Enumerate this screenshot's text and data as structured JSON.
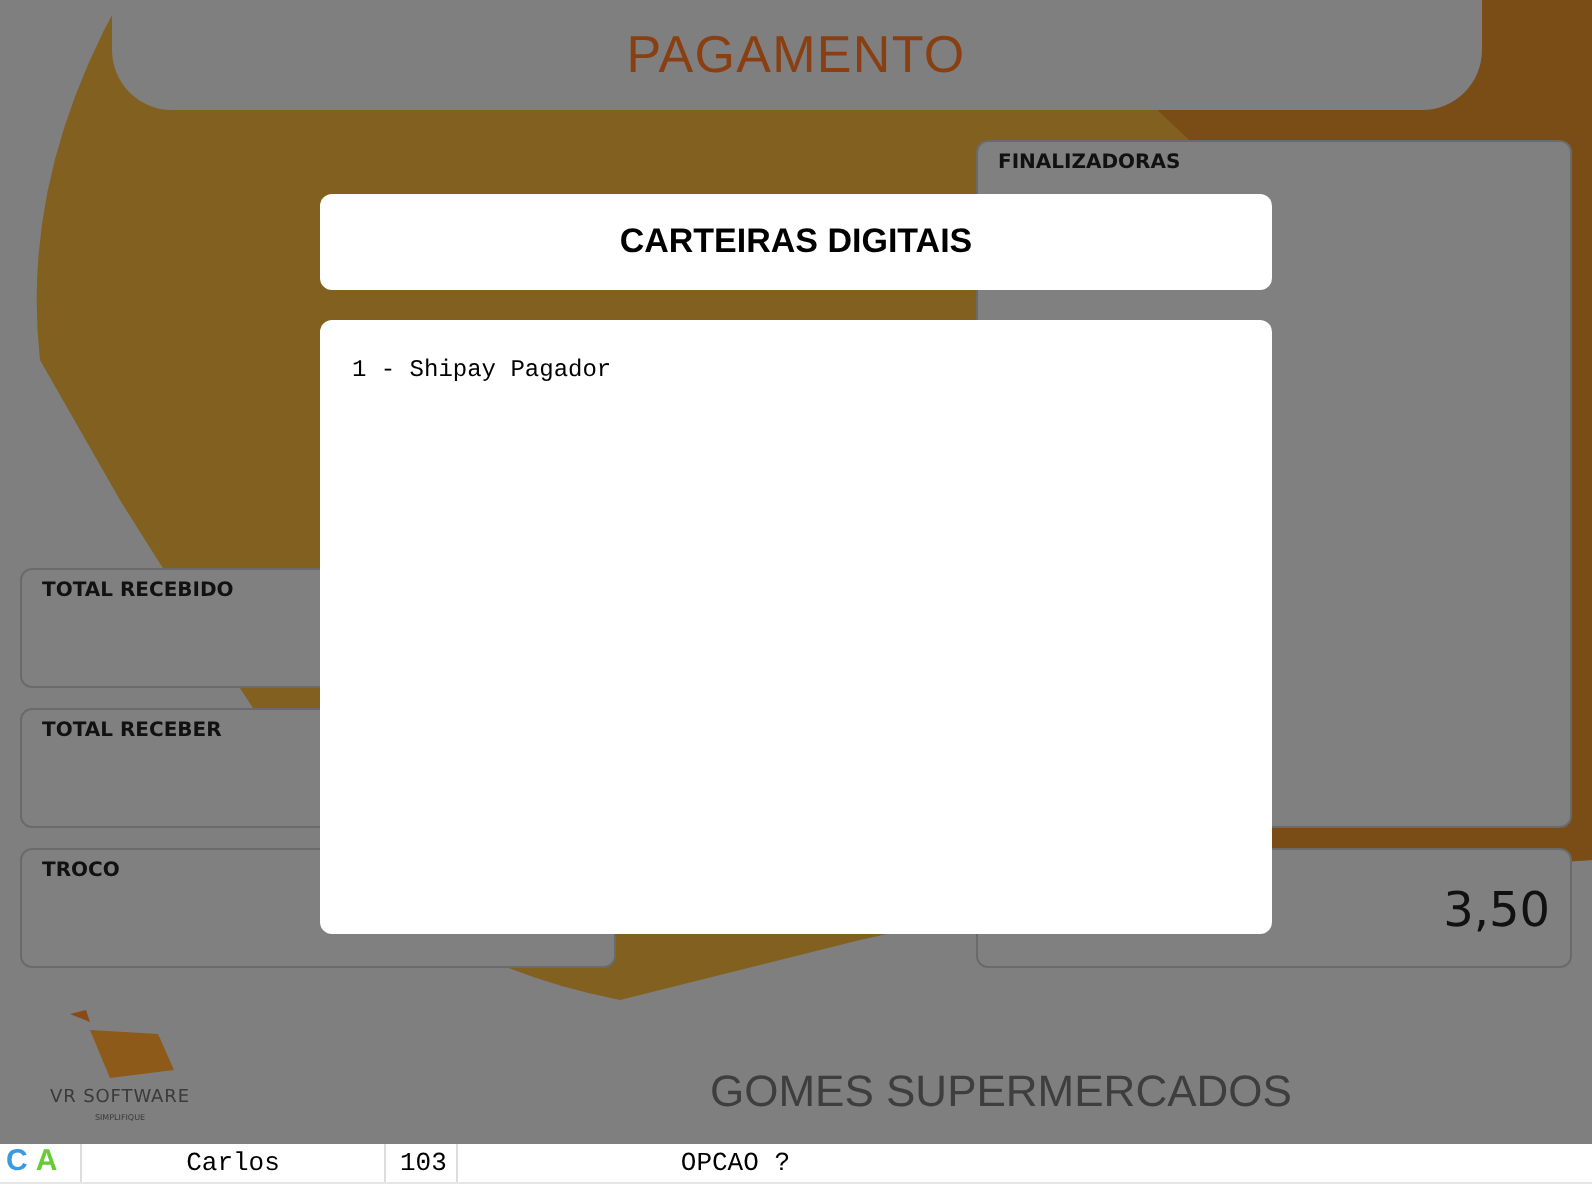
{
  "title": "PAGAMENTO",
  "left_panels": [
    {
      "label": "TOTAL RECEBIDO"
    },
    {
      "label": "TOTAL RECEBER"
    },
    {
      "label": "TROCO"
    }
  ],
  "finalizadoras": {
    "label": "FINALIZADORAS"
  },
  "right_total": {
    "value": "3,50"
  },
  "logo": {
    "name": "VR SOFTWARE",
    "tagline": "SIMPLIFIQUE"
  },
  "store_name": "GOMES SUPERMERCADOS",
  "dialog": {
    "title": "CARTEIRAS DIGITAIS",
    "options": [
      "1 - Shipay Pagador"
    ]
  },
  "status_bar": {
    "indicators": [
      {
        "letter": "C",
        "color": "#3b9be0"
      },
      {
        "letter": "A",
        "color": "#66cc33"
      }
    ],
    "operator": "Carlos",
    "number": "103",
    "prompt": "OPCAO ?"
  }
}
